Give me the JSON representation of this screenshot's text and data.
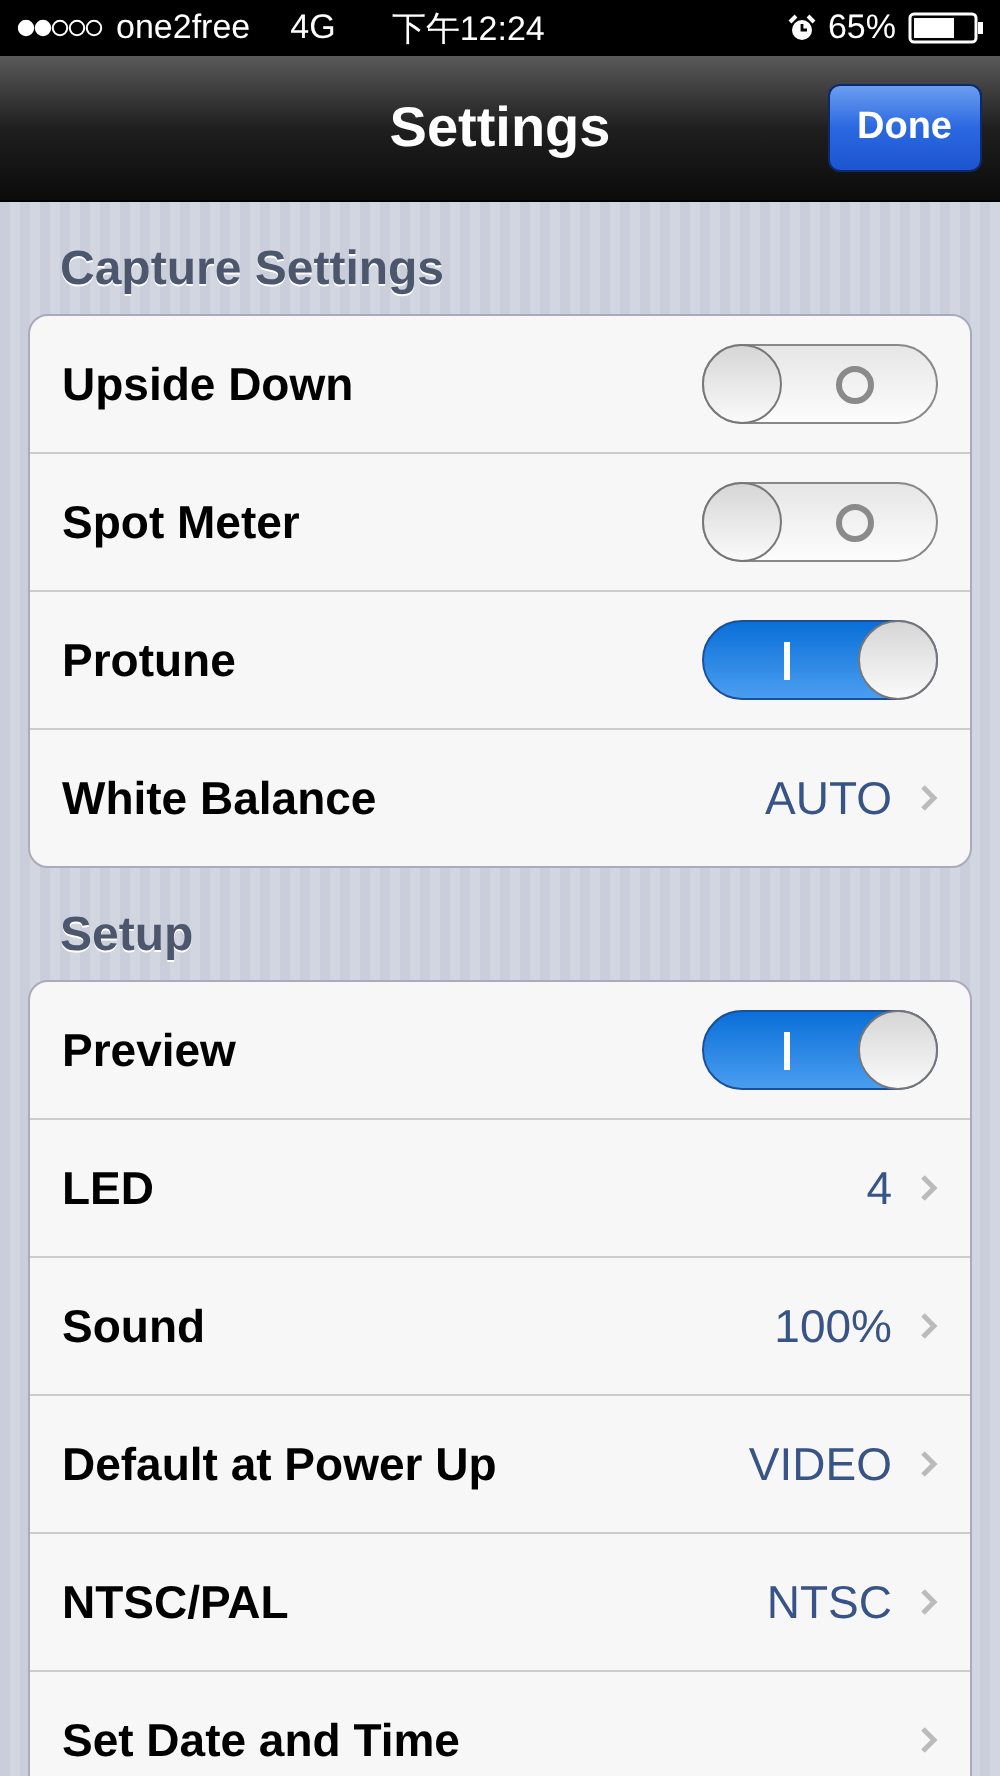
{
  "status_bar": {
    "carrier": "one2free",
    "network": "4G",
    "time": "下午12:24",
    "battery": "65%"
  },
  "nav_bar": {
    "title": "Settings",
    "button": "Done"
  },
  "sections": [
    {
      "title": "Capture Settings",
      "rows": [
        {
          "kind": "toggle",
          "label": "Upside Down",
          "on": false
        },
        {
          "kind": "toggle",
          "label": "Spot Meter",
          "on": false
        },
        {
          "kind": "toggle",
          "label": "Protune",
          "on": true
        },
        {
          "kind": "value",
          "label": "White Balance",
          "value": "AUTO"
        }
      ]
    },
    {
      "title": "Setup",
      "rows": [
        {
          "kind": "toggle",
          "label": "Preview",
          "on": true
        },
        {
          "kind": "value",
          "label": "LED",
          "value": "4"
        },
        {
          "kind": "value",
          "label": "Sound",
          "value": "100%"
        },
        {
          "kind": "value",
          "label": "Default at Power Up",
          "value": "VIDEO"
        },
        {
          "kind": "value",
          "label": "NTSC/PAL",
          "value": "NTSC"
        },
        {
          "kind": "link",
          "label": "Set Date and Time"
        }
      ]
    }
  ]
}
